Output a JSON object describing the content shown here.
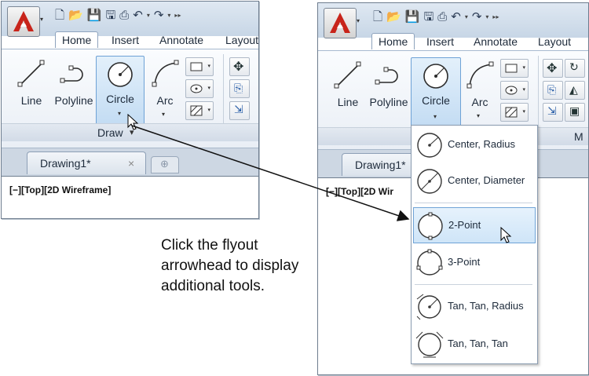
{
  "left_window": {
    "tabs": [
      "Home",
      "Insert",
      "Annotate",
      "Layout"
    ],
    "tools": {
      "line": "Line",
      "polyline": "Polyline",
      "circle": "Circle",
      "arc": "Arc"
    },
    "group_label": "Draw",
    "group_arrow": "▾",
    "doc_tab": "Drawing1*",
    "doc_close": "×",
    "viewport_label": "[−][Top][2D Wireframe]"
  },
  "right_window": {
    "tabs": [
      "Home",
      "Insert",
      "Annotate",
      "Layout"
    ],
    "tools": {
      "line": "Line",
      "polyline": "Polyline",
      "circle": "Circle",
      "arc": "Arc"
    },
    "group_label_partial": "M",
    "doc_tab": "Drawing1*",
    "viewport_label_partial": "[−][Top][2D Wir",
    "flyout": [
      {
        "label": "Center, Radius",
        "icon": "circle-center-radius-icon"
      },
      {
        "label": "Center, Diameter",
        "icon": "circle-center-diameter-icon"
      },
      {
        "label": "2-Point",
        "icon": "circle-2-point-icon",
        "highlighted": true
      },
      {
        "label": "3-Point",
        "icon": "circle-3-point-icon"
      },
      {
        "label": "Tan, Tan, Radius",
        "icon": "circle-tan-tan-radius-icon"
      },
      {
        "label": "Tan, Tan, Tan",
        "icon": "circle-tan-tan-tan-icon"
      }
    ]
  },
  "caption": {
    "line1": "Click the flyout",
    "line2": "arrowhead to display",
    "line3": "additional tools."
  },
  "colors": {
    "accent_red": "#c8241a",
    "highlight_blue": "#cfe5f8",
    "highlight_border": "#6fa3d6"
  }
}
